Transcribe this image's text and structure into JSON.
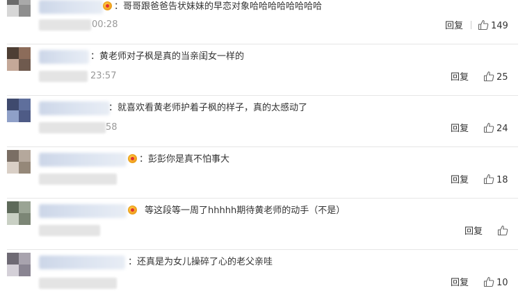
{
  "actions": {
    "reply_label": "回复"
  },
  "comments": [
    {
      "text": "：哥哥跟爸爸告状妹妹的早恋对象哈哈哈哈哈哈哈哈",
      "time_partial": "00:28",
      "likes": "149",
      "crown": true,
      "avatar_colors": [
        "#6b6b6b",
        "#a9a9a9",
        "#d7d7d7",
        "#8e8e8e"
      ]
    },
    {
      "text": "：黄老师对子枫是真的当亲闺女一样的",
      "time_partial": "23:57",
      "likes": "25",
      "crown": false,
      "avatar_colors": [
        "#4e3e34",
        "#8c6c5a",
        "#c4a898",
        "#6f5a4e"
      ]
    },
    {
      "text": "：就喜欢看黄老师护着子枫的样子，真的太感动了",
      "time_partial": "58",
      "likes": "24",
      "crown": false,
      "avatar_colors": [
        "#3f4a6e",
        "#5f6f9c",
        "#8fa0c8",
        "#4e5b86"
      ]
    },
    {
      "text": "：彭彭你是真不怕事大",
      "time_partial": "",
      "likes": "18",
      "crown": true,
      "avatar_colors": [
        "#7a6e64",
        "#b5a89c",
        "#d9cfc6",
        "#958879"
      ]
    },
    {
      "text": "等这段等一周了hhhhh期待黄老师的动手（不是）",
      "time_partial": "",
      "likes": "",
      "crown": true,
      "avatar_colors": [
        "#5e6a5a",
        "#9aa494",
        "#c9d0c4",
        "#7c8676"
      ]
    },
    {
      "text": "：还真是为女儿操碎了心的老父亲哇",
      "time_partial": "",
      "likes": "10",
      "crown": false,
      "avatar_colors": [
        "#6e6a74",
        "#a8a3ae",
        "#d4d0d8",
        "#8a8592"
      ]
    }
  ]
}
